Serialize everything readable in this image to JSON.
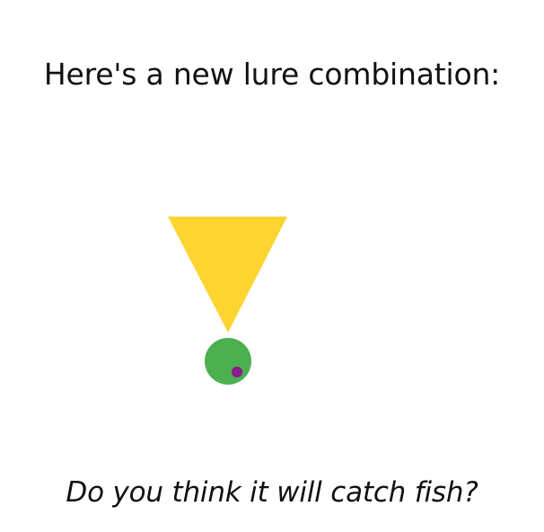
{
  "heading": "Here's a new lure combination:",
  "question": "Do you think it will catch fish?",
  "lure": {
    "parts": [
      {
        "name": "triangle",
        "color": "#FDD430",
        "pointing": "down"
      },
      {
        "name": "circle",
        "color": "#4CAF50"
      },
      {
        "name": "dot",
        "color": "#8B1A8F"
      }
    ]
  }
}
